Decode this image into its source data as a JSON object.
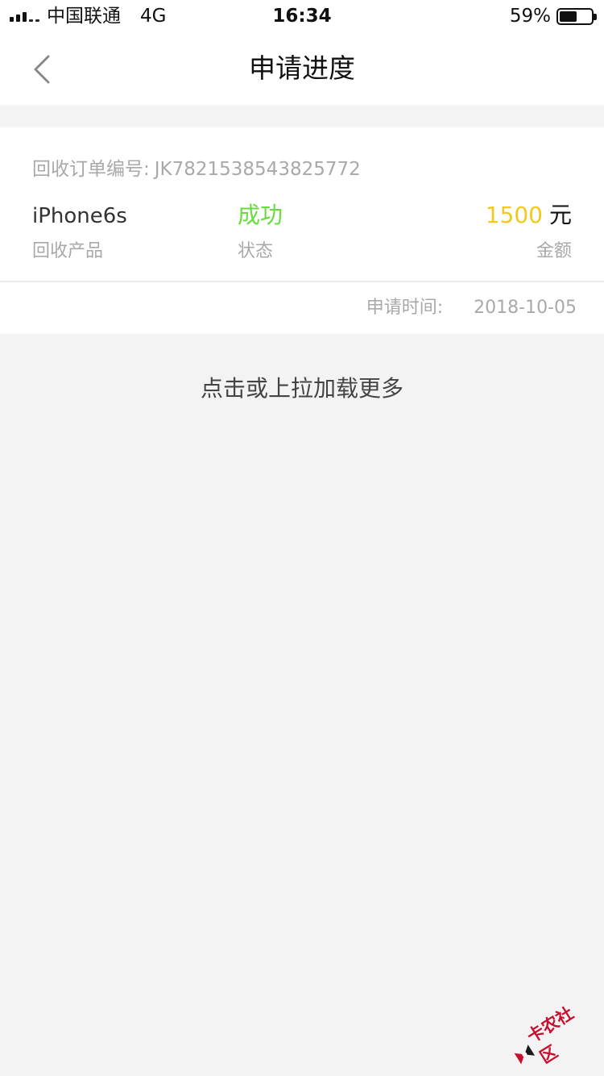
{
  "status_bar": {
    "carrier": "中国联通",
    "network": "4G",
    "time": "16:34",
    "battery_percent_text": "59%",
    "battery_level": 0.59
  },
  "nav": {
    "back_icon": "chevron-left-icon",
    "title": "申请进度"
  },
  "order": {
    "number_label": "回收订单编号:",
    "number_value": "JK7821538543825772",
    "product_value": "iPhone6s",
    "product_label": "回收产品",
    "status_value": "成功",
    "status_label": "状态",
    "amount_value": "1500",
    "amount_unit": "元",
    "amount_label": "金额",
    "apply_time_label": "申请时间:",
    "apply_time_value": "2018-10-05"
  },
  "load_more": "点击或上拉加载更多",
  "watermark": {
    "text": "卡农社区"
  },
  "colors": {
    "success": "#66dd3c",
    "amount": "#f2c91c",
    "muted_text": "#a9a9a9",
    "background": "#f3f3f3",
    "watermark": "#c8102e"
  }
}
